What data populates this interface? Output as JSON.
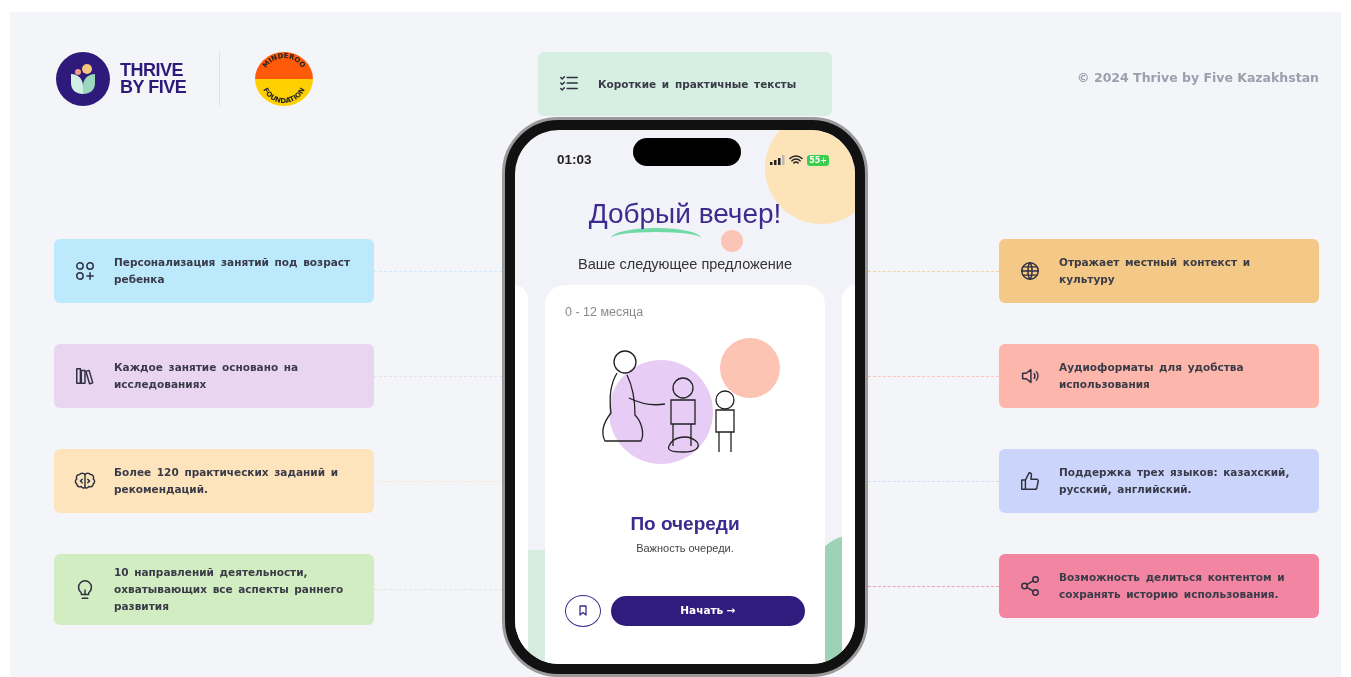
{
  "logos": {
    "brand_line_1": "THRIVE",
    "brand_line_2": "BY FIVE",
    "partner_top": "MINDEROO",
    "partner_bottom": "FOUNDATION"
  },
  "top_feature": {
    "text": "Короткие и практичные тексты",
    "color": "#d6efe2"
  },
  "copyright": "© 2024 Thrive by Five Kazakhstan",
  "left_features": [
    {
      "text": "Персонализация занятий под возраст ребенка",
      "color": "#bde9fd"
    },
    {
      "text": "Каждое занятие основано на исследованиях",
      "color": "#ead5f1"
    },
    {
      "text": "Более 120 практических заданий и рекомендаций.",
      "color": "#fee4bd"
    },
    {
      "text": "10 направлений деятельности, охватывающих все аспекты раннего развития",
      "color": "#d2edc1"
    }
  ],
  "right_features": [
    {
      "text": "Отражает местный контекст и культуру",
      "color": "#f4c987"
    },
    {
      "text": "Аудиоформаты для удобства использования",
      "color": "#fdb6ab"
    },
    {
      "text": "Поддержка трех языков: казахский, русский, английский.",
      "color": "#cbd5fc"
    },
    {
      "text": "Возможность делиться контентом и сохранять историю использования.",
      "color": "#f286a2"
    }
  ],
  "phone": {
    "status_bar": {
      "time": "01:03",
      "battery": "55+"
    },
    "greeting": "Добрый вечер!",
    "subtitle": "Ваше следующее предложение",
    "activity_card": {
      "age_range": "0 - 12 месяца",
      "title": "По очереди",
      "description": "Важность очереди.",
      "start_button": "Начать →"
    }
  }
}
